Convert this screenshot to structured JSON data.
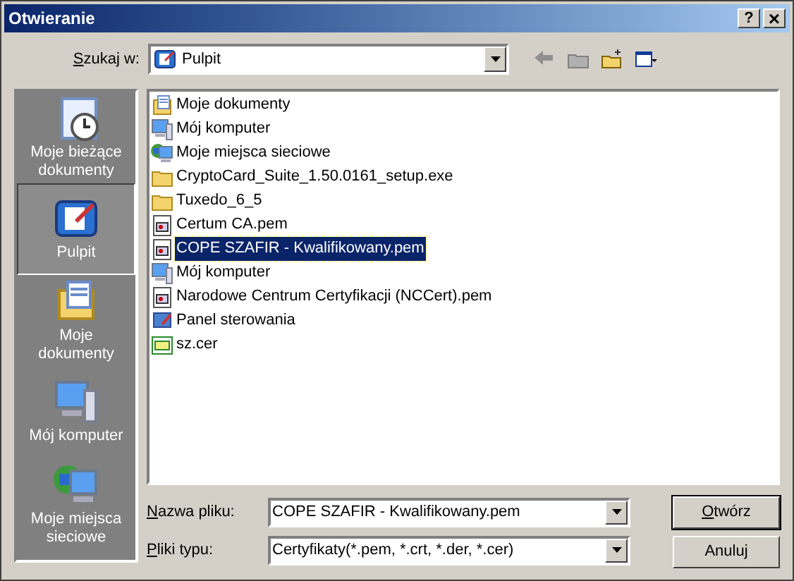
{
  "window": {
    "title": "Otwieranie"
  },
  "title_buttons": [
    {
      "kind": "help",
      "label": "?"
    },
    {
      "kind": "close",
      "label": "×"
    }
  ],
  "look_in": {
    "label": "Szukaj w:",
    "underline_first": true,
    "value": "Pulpit"
  },
  "places": [
    {
      "label": "Moje bieżące dokumenty",
      "kind": "recent",
      "selected": false
    },
    {
      "label": "Pulpit",
      "kind": "desktop",
      "selected": true
    },
    {
      "label": "Moje dokumenty",
      "kind": "documents",
      "selected": false
    },
    {
      "label": "Mój komputer",
      "kind": "computer",
      "selected": false
    },
    {
      "label": "Moje miejsca sieciowe",
      "kind": "network",
      "selected": false
    }
  ],
  "files": [
    {
      "name": "Moje dokumenty",
      "kind": "documents",
      "selected": false
    },
    {
      "name": "Mój komputer",
      "kind": "computer",
      "selected": false
    },
    {
      "name": "Moje miejsca sieciowe",
      "kind": "network",
      "selected": false
    },
    {
      "name": "CryptoCard_Suite_1.50.0161_setup.exe",
      "kind": "folder",
      "selected": false
    },
    {
      "name": "Tuxedo_6_5",
      "kind": "folder",
      "selected": false
    },
    {
      "name": "Certum CA.pem",
      "kind": "cert",
      "selected": false
    },
    {
      "name": "COPE SZAFIR - Kwalifikowany.pem",
      "kind": "cert",
      "selected": true
    },
    {
      "name": "Mój komputer",
      "kind": "computer",
      "selected": false
    },
    {
      "name": "Narodowe Centrum Certyfikacji (NCCert).pem",
      "kind": "cert",
      "selected": false
    },
    {
      "name": "Panel sterowania",
      "kind": "control",
      "selected": false
    },
    {
      "name": "sz.cer",
      "kind": "cer",
      "selected": false
    }
  ],
  "file_name": {
    "label": "Nazwa pliku:",
    "underline_first": true,
    "value": "COPE SZAFIR - Kwalifikowany.pem"
  },
  "file_type": {
    "label": "Pliki typu:",
    "underline_first": true,
    "value": "Certyfikaty(*.pem, *.crt, *.der, *.cer)"
  },
  "buttons": [
    {
      "label": "Otwórz",
      "underline_first": true,
      "default": true
    },
    {
      "label": "Anuluj",
      "underline_first": false,
      "default": false
    }
  ]
}
